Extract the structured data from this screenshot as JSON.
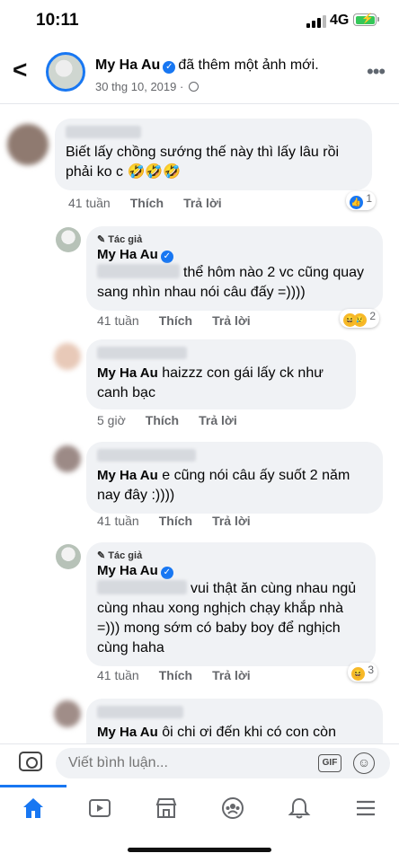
{
  "status": {
    "time": "10:11",
    "network": "4G"
  },
  "header": {
    "author": "My Ha Au",
    "action": "đã thêm một ảnh mới.",
    "date": "30 thg 10, 2019 · "
  },
  "comments": [
    {
      "text": "Biết lấy chồng sướng thế này thì lấy lâu rồi phải ko c 🤣🤣🤣",
      "time": "41 tuần",
      "like": "Thích",
      "reply": "Trả lời",
      "reactions": "1"
    },
    {
      "author_tag": "Tác giả",
      "name": "My Ha Au",
      "text": "thể hôm nào 2 vc cũng quay sang nhìn nhau nói câu đấy =))))",
      "time": "41 tuần",
      "like": "Thích",
      "reply": "Trả lời",
      "reactions": "2"
    },
    {
      "name": "My Ha Au",
      "text": "haizzz con gái lấy ck như canh bạc",
      "time": "5 giờ",
      "like": "Thích",
      "reply": "Trả lời"
    },
    {
      "name": "My Ha Au",
      "text": "e cũng nói câu ấy suốt 2 năm nay đây :))))",
      "time": "41 tuần",
      "like": "Thích",
      "reply": "Trả lời"
    },
    {
      "author_tag": "Tác giả",
      "name": "My Ha Au",
      "text": "vui thật ăn cùng nhau ngủ cùng nhau xong nghịch chạy khắp nhà =))) mong sớm có baby boy để nghịch cùng haha",
      "time": "41 tuần",
      "like": "Thích",
      "reply": "Trả lời",
      "reactions": "3"
    },
    {
      "name": "My Ha Au",
      "text": "ôi chi ơi đến khi có con còn"
    }
  ],
  "composer": {
    "placeholder": "Viết bình luận...",
    "gif_label": "GIF"
  },
  "tabs": [
    "home-icon",
    "video-icon",
    "marketplace-icon",
    "groups-icon",
    "notifications-icon",
    "menu-icon"
  ],
  "colors": {
    "accent": "#1877f2",
    "bubble": "#f0f2f5",
    "meta": "#65676b"
  }
}
